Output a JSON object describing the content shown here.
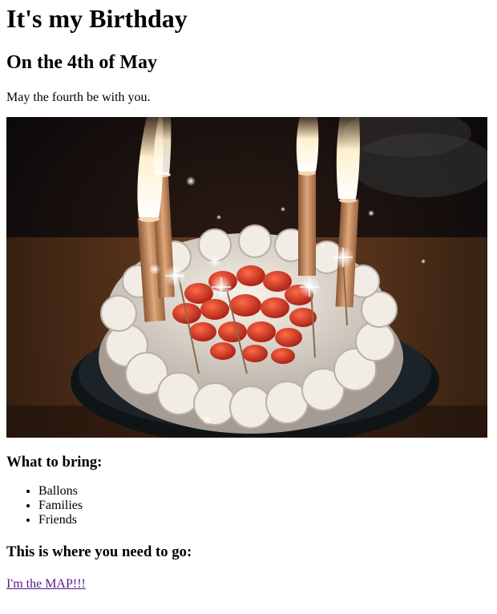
{
  "page": {
    "title": "It's my Birthday",
    "subtitle_heading": "On the 4th of May",
    "tagline": "May the fourth be with you."
  },
  "image": {
    "icon": "birthday-cake-photo",
    "colors": {
      "background": "#0d0a08",
      "table": "#6b3d1e",
      "plate": "#101418",
      "frosting": "#ece7df",
      "strawberry": "#d23a22",
      "candle": "#c98c5f",
      "flame": "#fff4d6"
    }
  },
  "bring": {
    "heading": "What to bring:",
    "items": [
      "Ballons",
      "Families",
      "Friends"
    ]
  },
  "directions": {
    "heading": "This is where you need to go:",
    "link_label": "I'm the MAP!!!",
    "link_color": "#551a8b"
  }
}
